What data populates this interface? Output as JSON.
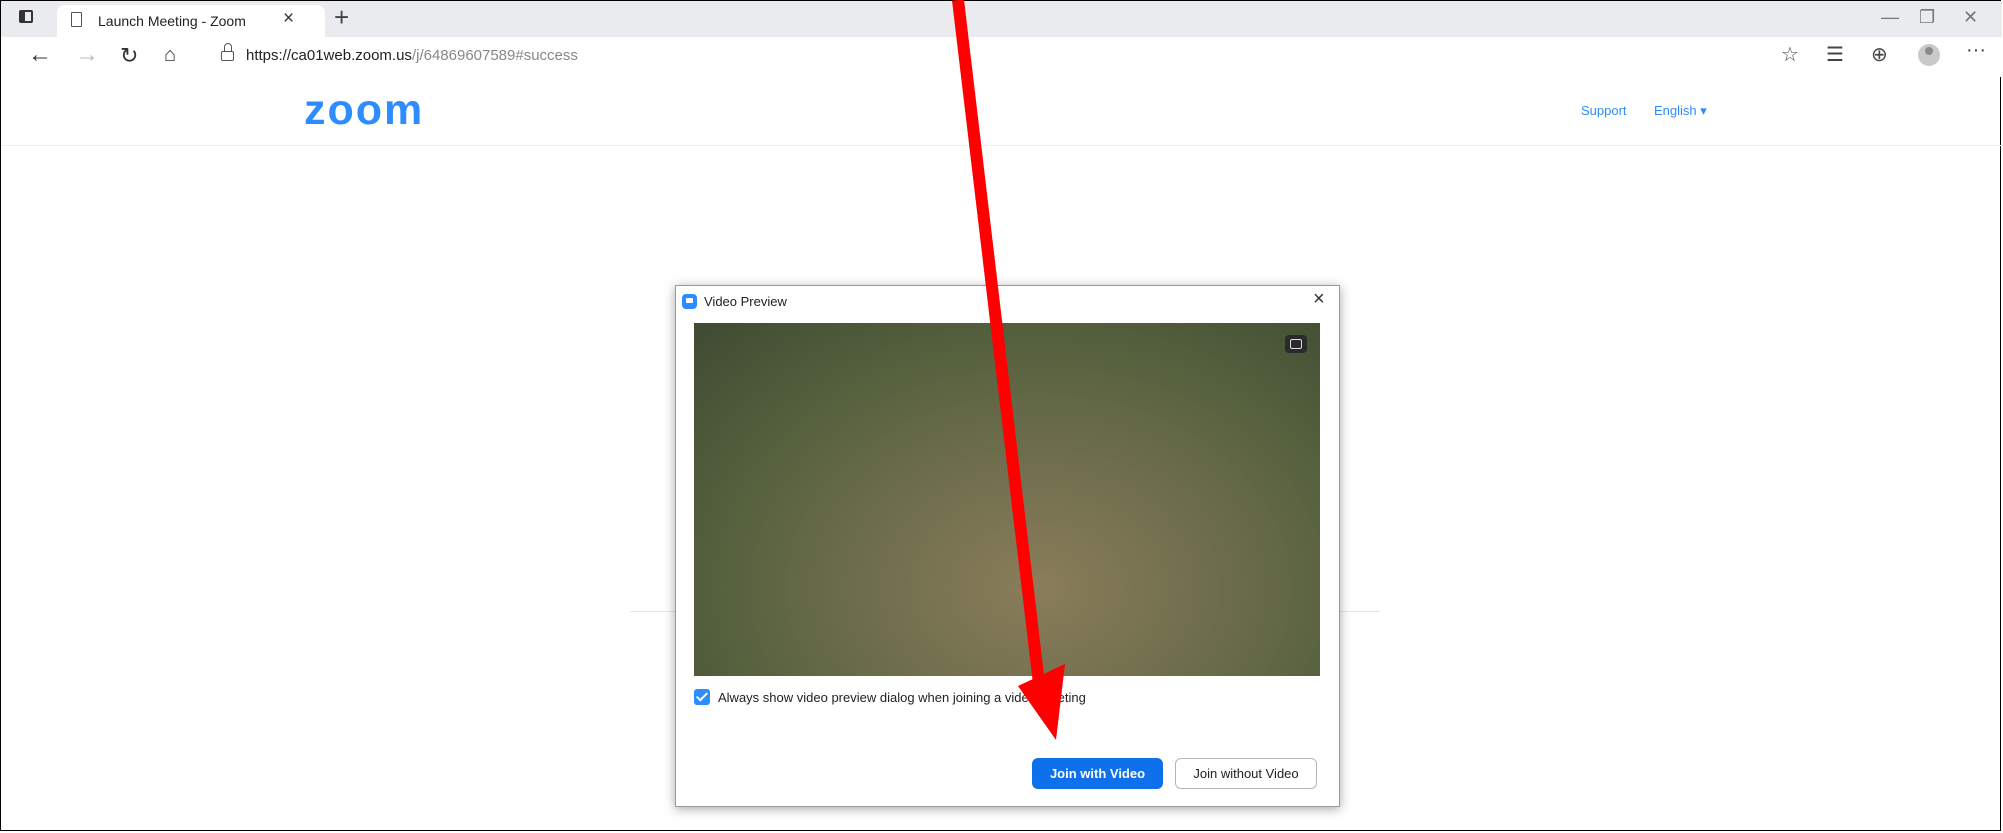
{
  "browser": {
    "tab_title": "Launch Meeting - Zoom",
    "tab_close": "×",
    "new_tab": "+",
    "url_main": "https://ca01web.zoom.us",
    "url_path": "/j/64869607589#success",
    "window_controls": {
      "minimize": "—",
      "restore": "❐",
      "close": "✕"
    }
  },
  "page": {
    "logo": "zoom",
    "support_link": "Support",
    "language": "English ▾"
  },
  "dialog": {
    "title": "Video Preview",
    "close": "×",
    "checkbox_label": "Always show video preview dialog when joining a video meeting",
    "checkbox_checked": true,
    "join_with_video": "Join with Video",
    "join_without_video": "Join without Video"
  },
  "icons": [
    "tab-actions-icon",
    "page-icon",
    "back-icon",
    "forward-icon",
    "refresh-icon",
    "home-icon",
    "lock-icon",
    "favorite-add-icon",
    "favorites-icon",
    "collections-icon",
    "profile-icon",
    "more-icon",
    "zoom-app-icon",
    "background-icon",
    "checkbox-check-icon",
    "annotation-arrow"
  ],
  "colors": {
    "accent": "#2D8CFF",
    "join_button": "#0e71eb",
    "annotation": "#ff0000"
  }
}
